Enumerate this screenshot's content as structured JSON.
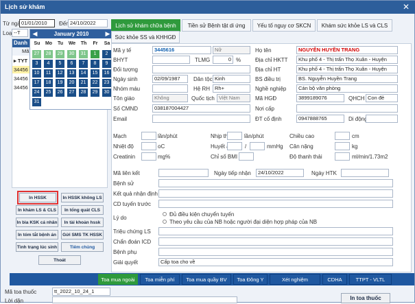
{
  "window": {
    "title": "Lịch sử khám",
    "close": "✕"
  },
  "filter": {
    "from_label": "Từ ngày",
    "from_value": "01/01/2010",
    "to_label": "Đến",
    "to_value": "24/10/2022",
    "type_label": "Loại",
    "type_value": "--T"
  },
  "calendar": {
    "month": "January 2010",
    "prev": "◀",
    "next": "▶",
    "weekdays": [
      "Su",
      "Mo",
      "Tu",
      "We",
      "Th",
      "Fr",
      "Sa"
    ],
    "rows": [
      [
        "27",
        "28",
        "29",
        "30",
        "31",
        "1",
        "2"
      ],
      [
        "3",
        "4",
        "5",
        "6",
        "7",
        "8",
        "9"
      ],
      [
        "10",
        "11",
        "12",
        "13",
        "14",
        "15",
        "16"
      ],
      [
        "17",
        "18",
        "19",
        "20",
        "21",
        "22",
        "23"
      ],
      [
        "24",
        "25",
        "26",
        "27",
        "28",
        "29",
        "30"
      ],
      [
        "31"
      ]
    ]
  },
  "left_list": {
    "header": "Danh",
    "col": "Mã",
    "group": "TYT",
    "rows": [
      "34456",
      "34456",
      "34456"
    ]
  },
  "left_buttons": [
    [
      "In HSSK",
      "In HSSK không LS"
    ],
    [
      "In khám LS & CLS",
      "In tổng quát CLS"
    ],
    [
      "In bìa KSK cá nhân",
      "In tài khoản hssk"
    ],
    [
      "In tóm tắt bệnh án",
      "Gửi SMS TK HSSK"
    ],
    [
      "Tình trạng lúc sinh",
      "Tiêm chủng"
    ],
    [
      "Thoát"
    ]
  ],
  "tabs": [
    "Lịch sử khám chữa bệnh",
    "Tiền sử Bệnh tật di ứng",
    "Yếu tố nguy cơ SKCN",
    "Khám sức khỏe LS và CLS",
    "Sức khỏe SS và KHHGĐ"
  ],
  "patient": {
    "ma_yte_label": "Mã y tế",
    "ma_yte": "3445616",
    "gioi_tinh": "Nữ",
    "ho_ten_label": "Họ tên",
    "ho_ten": "NGUYỄN HUYỀN TRANG",
    "bhyt_label": "BHYT",
    "tlmg_label": "TLMG",
    "tlmg": "0",
    "pct": "%",
    "dc_hktt_label": "Địa chỉ HKTT",
    "dc_hktt": "Khu phố 4 - Thị trấn Thọ Xuân - Huyện",
    "doi_tuong_label": "Đối tượng",
    "dc_ht_label": "Địa chỉ HT",
    "dc_ht": "Khu phố 4 - Thị trấn Thọ Xuân - Huyện",
    "ngay_sinh_label": "Ngày sinh",
    "ngay_sinh": "02/09/1987",
    "dan_toc_label": "Dân tộc",
    "dan_toc": "Kinh",
    "bs_label": "BS điều trị",
    "bs": "BS. Nguyễn Huyền Trang",
    "nhom_mau_label": "Nhóm máu",
    "he_rh_label": "Hệ RH",
    "he_rh": "Rh+",
    "nghe_label": "Nghề nghiệp",
    "nghe": "Cán bộ văn phòng",
    "ton_giao_label": "Tôn giáo",
    "ton_giao": "Không",
    "quoc_tich_label": "Quốc tịch",
    "quoc_tich": "Việt Nam",
    "ma_hgd_label": "Mã HGĐ",
    "ma_hgd": "3899189076",
    "qhch_label": "QHCH",
    "qhch": "Con đẻ",
    "cmnd_label": "Số CMND",
    "cmnd": "038187004427",
    "noi_cap_label": "Nơi cấp",
    "email_label": "Email",
    "dt_label": "ĐT cố định",
    "dt": "0947888765",
    "dd_label": "Di động"
  },
  "vitals": {
    "mach": "Mạch",
    "mach_u": "lần/phút",
    "nhip_tho": "Nhịp thở",
    "nhip_tho_u": "lần/phút",
    "chieu_cao": "Chiều cao",
    "chieu_cao_u": "cm",
    "nhiet_do": "Nhiệt độ",
    "nhiet_do_u": "oC",
    "huyet_ap": "Huyết áp",
    "huyet_ap_sep": "/",
    "huyet_ap_u": "mmHg",
    "can_nang": "Cân nặng",
    "can_nang_u": "kg",
    "creatinin": "Creatinin",
    "creatinin_u": "mg%",
    "bmi": "Chỉ số BMI",
    "dtt": "Độ thanh thải",
    "dtt_u": "ml/min/1.73m2"
  },
  "visit": {
    "ma_lk_label": "Mã liên kết",
    "ngay_tn_label": "Ngày tiếp nhận",
    "ngay_tn": "24/10/2022",
    "ngay_htk_label": "Ngày HTK",
    "benh_su": "Bệnh sử",
    "kq_label": "Kết quả nhận định",
    "cd_label": "CD tuyến trước",
    "ly_do": "Lý do",
    "r1": "Đủ điều kiện chuyển tuyến",
    "r2": "Theo yêu cầu của NB hoặc người đại diện hợp pháp của NB",
    "trieu_chung": "Triệu chứng LS",
    "chan_doan": "Chẩn đoán ICD",
    "benh_phu": "Bệnh phụ",
    "giai_quyet": "Giải quyết",
    "giai_quyet_value": "Cấp toa cho về"
  },
  "bottom_tabs": [
    "Toa mua ngoài",
    "Toa miễn phí",
    "Toa mua quầy BV",
    "Toa Đông Y",
    "Xét nghiệm",
    "CDHA",
    "TTPT - VLTL"
  ],
  "bottom": {
    "ma_toa_label": "Mã toa thuốc",
    "ma_toa": "tt_2022_10_24_1",
    "loi_dan_label": "Lời dặn",
    "in_toa": "In toa thuốc"
  },
  "colors": {
    "title_bar": "#2d5e9b",
    "active_tab": "#2f9a3c",
    "calendar": "#1a4e88",
    "highlight": "#d40000"
  }
}
